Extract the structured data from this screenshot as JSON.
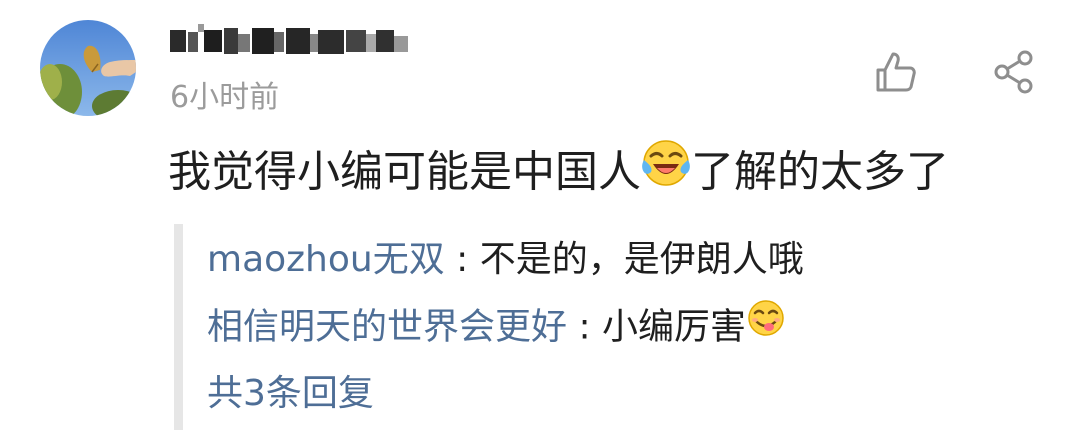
{
  "comment": {
    "timestamp": "6小时前",
    "text_before_emoji": "我觉得小编可能是中国人",
    "emoji_1": "laughing-crying-emoji",
    "text_after_emoji": "了解的太多了"
  },
  "actions": {
    "like_icon": "thumbs-up-icon",
    "share_icon": "share-icon"
  },
  "replies": [
    {
      "author": "maozhou无双",
      "separator": " : ",
      "text": "不是的，是伊朗人哦"
    },
    {
      "author": "相信明天的世界会更好",
      "separator": " : ",
      "text": "小编厉害",
      "emoji": "yum-face-emoji"
    }
  ],
  "more_replies": "共3条回复",
  "colors": {
    "link_blue": "#4e6e96",
    "timestamp_gray": "#9b9b9b",
    "text_dark": "#1f1f1f",
    "reply_border": "#e6e6e6"
  }
}
